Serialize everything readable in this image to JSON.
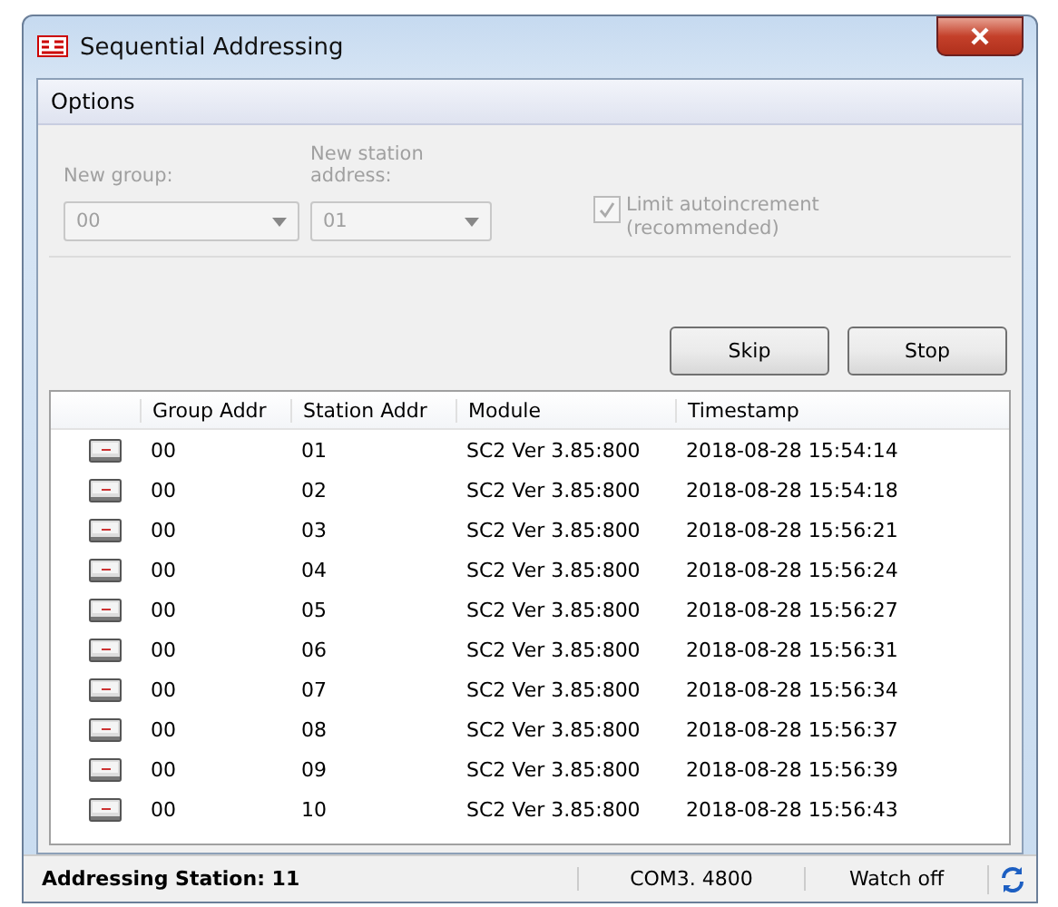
{
  "window": {
    "title": "Sequential Addressing"
  },
  "menu": [
    "Options"
  ],
  "options": {
    "disabled": true,
    "fields": [
      {
        "label": "New group:",
        "value": "00"
      },
      {
        "label": "New station address:",
        "value": "01"
      }
    ],
    "checkbox": {
      "label": "Limit autoincrement (recommended)",
      "checked": true
    }
  },
  "buttons": [
    "Skip",
    "Stop"
  ],
  "table": {
    "columns": [
      "Group Addr",
      "Station Addr",
      "Module",
      "Timestamp"
    ],
    "rows": [
      [
        "00",
        "01",
        "SC2 Ver 3.85:800",
        "2018-08-28 15:54:14"
      ],
      [
        "00",
        "02",
        "SC2 Ver 3.85:800",
        "2018-08-28 15:54:18"
      ],
      [
        "00",
        "03",
        "SC2 Ver 3.85:800",
        "2018-08-28 15:56:21"
      ],
      [
        "00",
        "04",
        "SC2 Ver 3.85:800",
        "2018-08-28 15:56:24"
      ],
      [
        "00",
        "05",
        "SC2 Ver 3.85:800",
        "2018-08-28 15:56:27"
      ],
      [
        "00",
        "06",
        "SC2 Ver 3.85:800",
        "2018-08-28 15:56:31"
      ],
      [
        "00",
        "07",
        "SC2 Ver 3.85:800",
        "2018-08-28 15:56:34"
      ],
      [
        "00",
        "08",
        "SC2 Ver 3.85:800",
        "2018-08-28 15:56:37"
      ],
      [
        "00",
        "09",
        "SC2 Ver 3.85:800",
        "2018-08-28 15:56:39"
      ],
      [
        "00",
        "10",
        "SC2 Ver 3.85:800",
        "2018-08-28 15:56:43"
      ]
    ]
  },
  "status_bar": [
    "Addressing Station: 11",
    "COM3. 4800",
    "Watch off"
  ]
}
